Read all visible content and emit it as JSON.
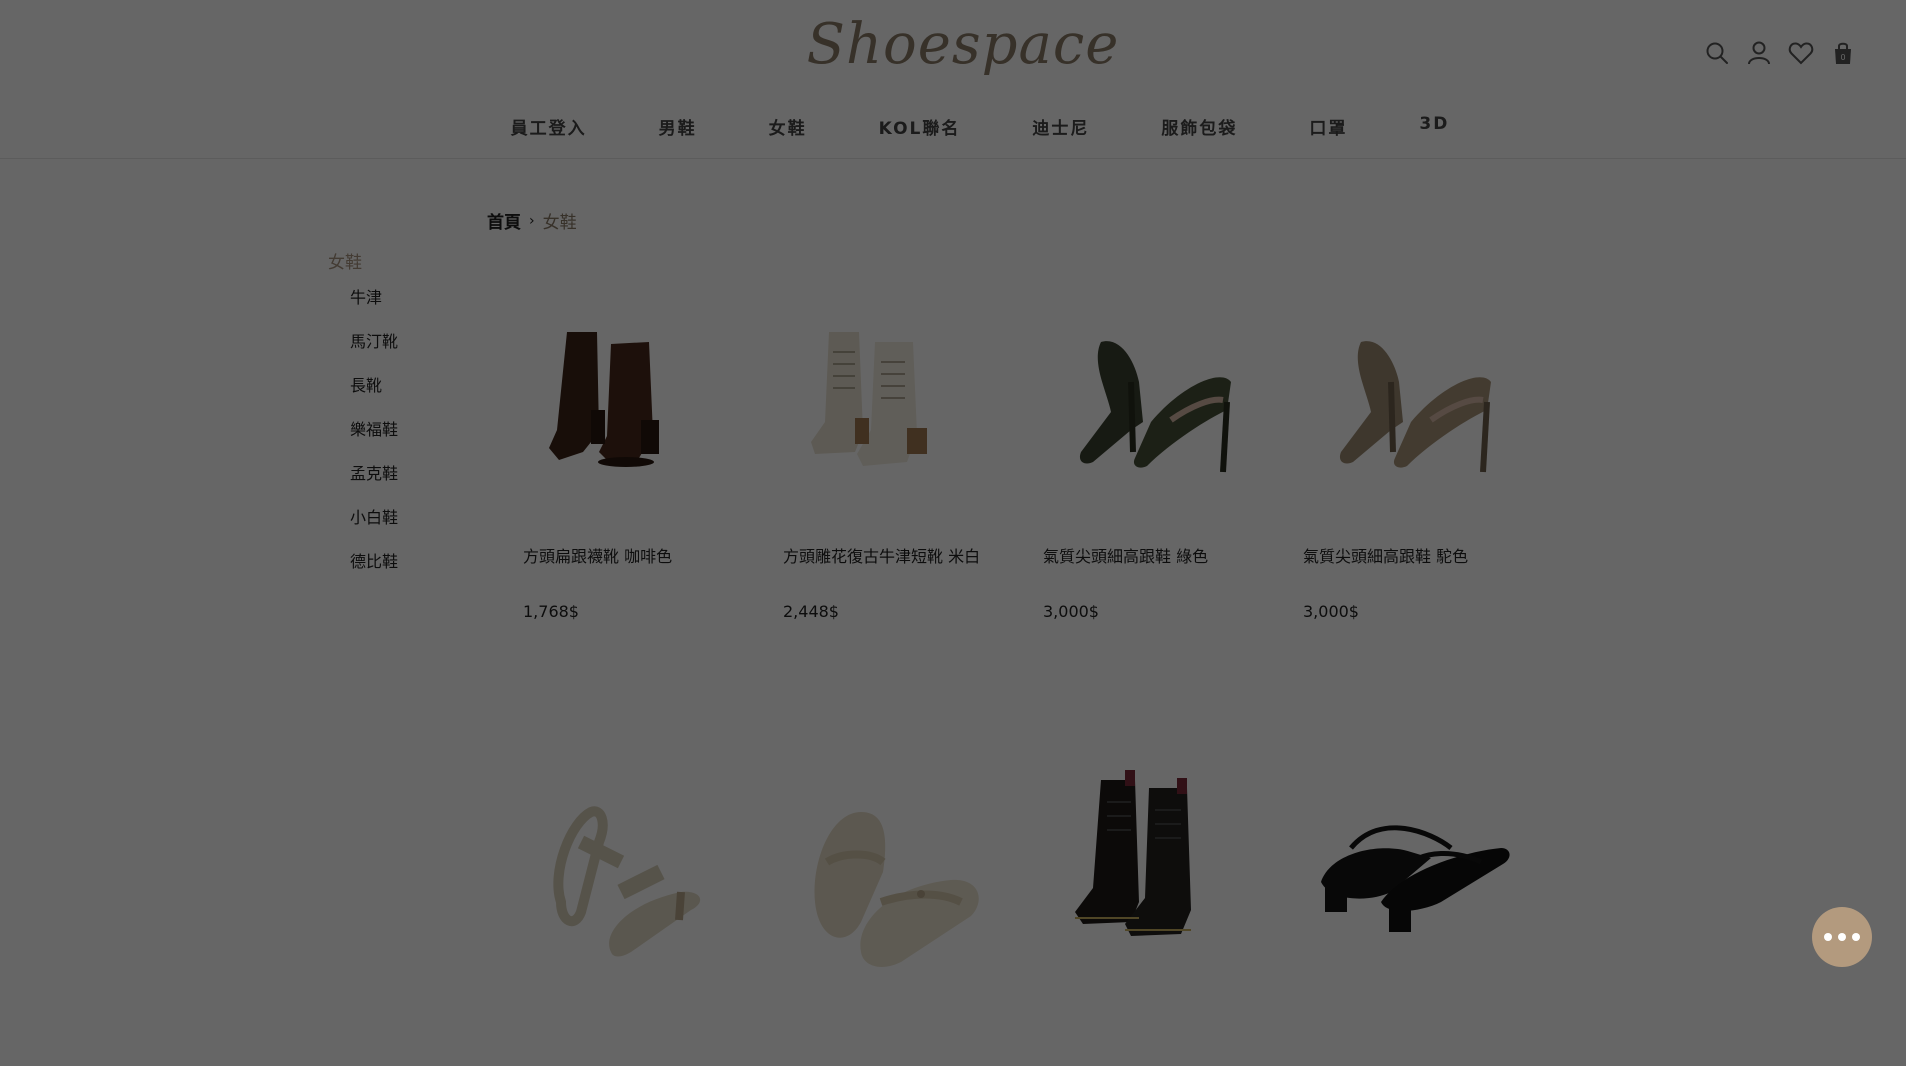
{
  "header": {
    "logo": "Shoespace",
    "icons": [
      "search-icon",
      "user-icon",
      "heart-icon",
      "cart-icon"
    ],
    "accent_color": "#8a7a68"
  },
  "nav": {
    "items": [
      "員工登入",
      "男鞋",
      "女鞋",
      "KOL聯名",
      "迪士尼",
      "服飾包袋",
      "口罩",
      "3D"
    ]
  },
  "breadcrumb": {
    "home": "首頁",
    "separator": "›",
    "current": "女鞋"
  },
  "sidebar": {
    "title": "女鞋",
    "items": [
      "牛津",
      "馬汀靴",
      "長靴",
      "樂福鞋",
      "孟克鞋",
      "小白鞋",
      "德比鞋"
    ]
  },
  "products": [
    {
      "name": "方頭扁跟襪靴 咖啡色",
      "price": "1,768$",
      "image": "brown-square-toe-ankle-boot"
    },
    {
      "name": "方頭雕花復古牛津短靴 米白",
      "price": "2,448$",
      "image": "cream-lace-up-oxford-boot"
    },
    {
      "name": "氣質尖頭細高跟鞋 綠色",
      "price": "3,000$",
      "image": "green-pointed-stiletto-pump"
    },
    {
      "name": "氣質尖頭細高跟鞋 駝色",
      "price": "3,000$",
      "image": "camel-pointed-stiletto-pump"
    },
    {
      "image": "cream-thong-sandal"
    },
    {
      "image": "cream-mary-jane-flat"
    },
    {
      "image": "black-lace-up-combat-boot"
    },
    {
      "image": "black-pointed-slingback-mule"
    }
  ],
  "chat": {
    "icon": "chat-bubble-icon"
  },
  "overlay_color": "#000000"
}
